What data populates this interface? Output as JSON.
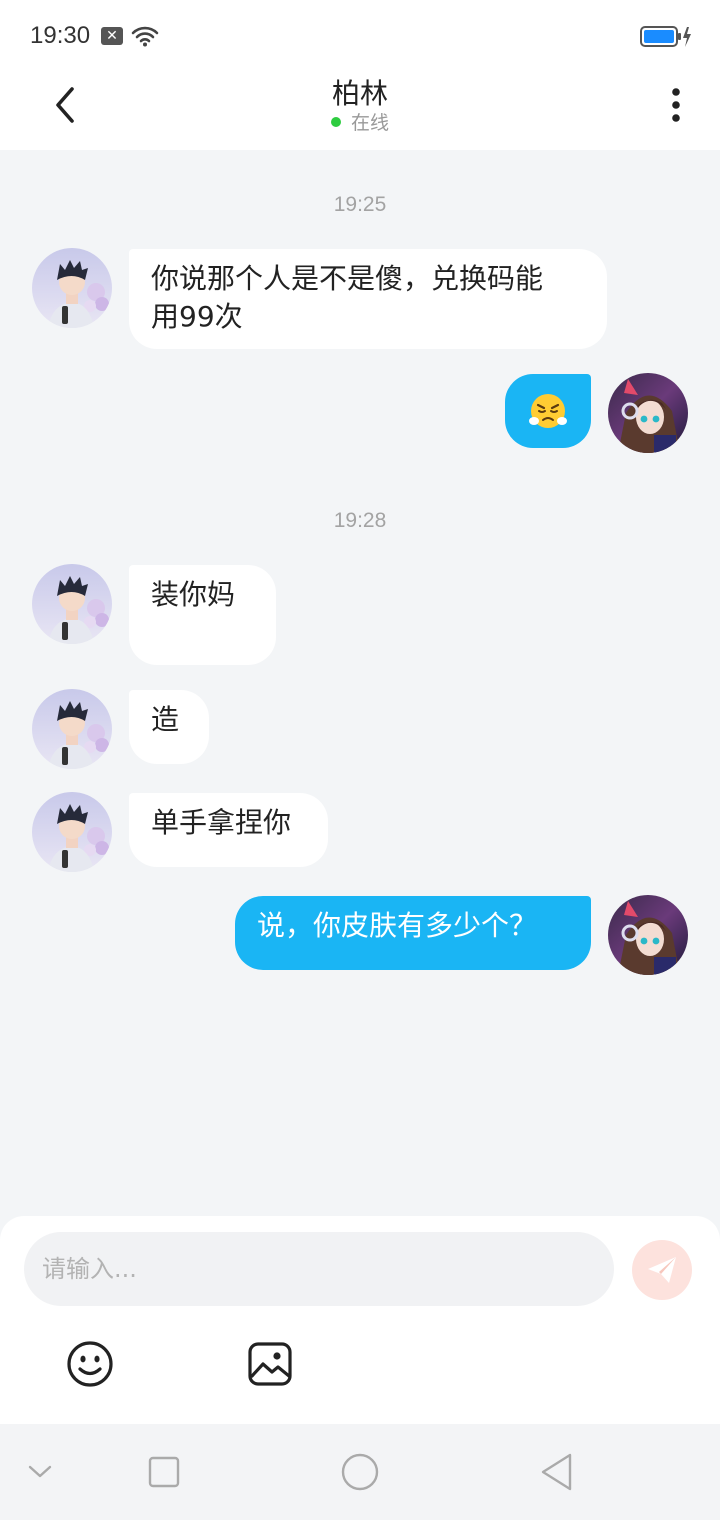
{
  "status_bar": {
    "time": "19:30",
    "notification_badge": "✕",
    "icons": [
      "close-notification-icon",
      "wifi-icon",
      "battery-charging-icon"
    ]
  },
  "header": {
    "title": "柏林",
    "status": "在线",
    "status_color": "#2ecc40",
    "back_icon": "chevron-left-icon",
    "more_icon": "more-vertical-icon"
  },
  "chat": {
    "groups": [
      {
        "timestamp": "19:25",
        "messages": [
          {
            "sender": "other",
            "text": "你说那个人是不是傻，兑换码能\n用99次"
          },
          {
            "sender": "me",
            "emoji": "😤"
          }
        ]
      },
      {
        "timestamp": "19:28",
        "messages": [
          {
            "sender": "other",
            "text": "装你妈"
          },
          {
            "sender": "other",
            "text": "造"
          },
          {
            "sender": "other",
            "text": "单手拿捏你"
          },
          {
            "sender": "me",
            "text": "说，你皮肤有多少个？"
          }
        ]
      }
    ]
  },
  "input": {
    "placeholder": "请输入...",
    "value": "",
    "send_icon": "send-icon",
    "emoji_icon": "emoji-icon",
    "image_icon": "image-icon"
  },
  "nav_bar": {
    "icons": [
      "chevron-down-icon",
      "recent-apps-icon",
      "home-icon",
      "back-triangle-icon"
    ]
  },
  "colors": {
    "accent": "#1ab5f4",
    "background": "#f3f5f7",
    "bubble_other": "#ffffff",
    "send_button": "#fde2dd"
  }
}
